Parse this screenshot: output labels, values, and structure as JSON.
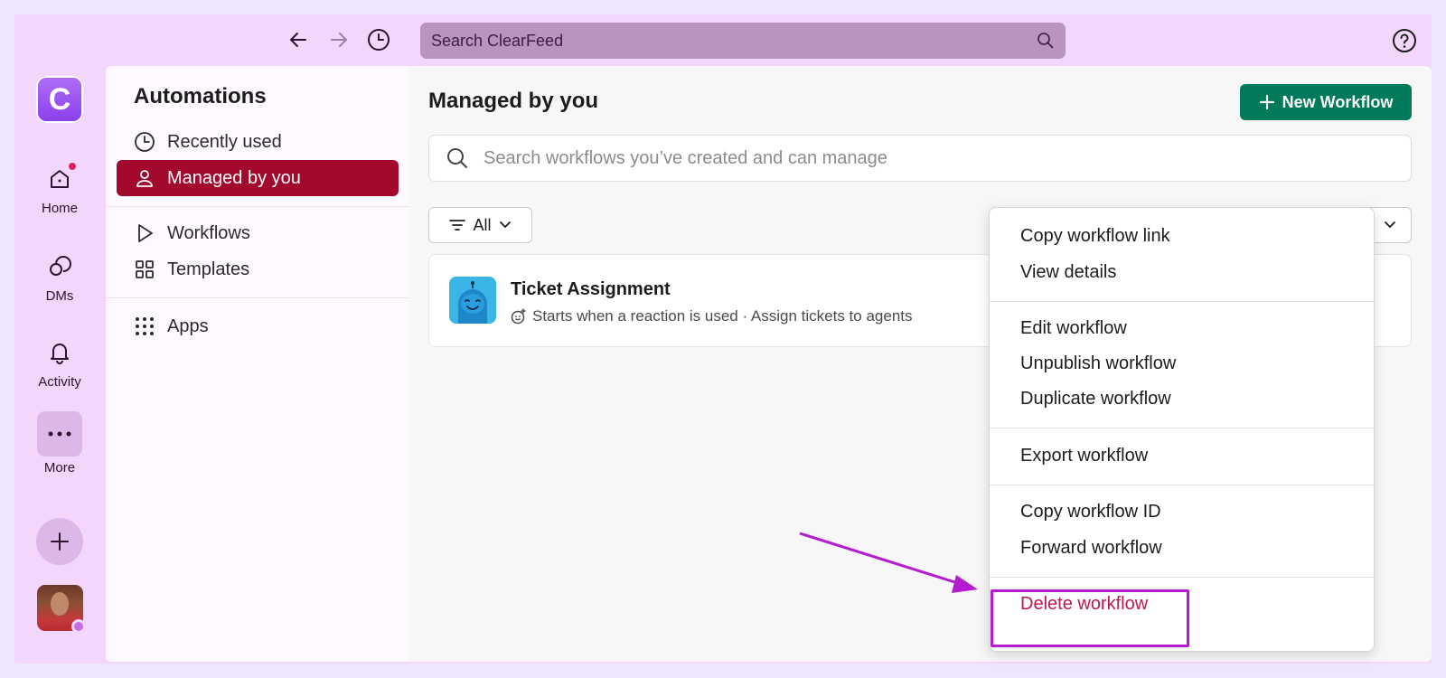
{
  "topbar": {
    "back_icon": "arrow-left-icon",
    "forward_icon": "arrow-right-icon",
    "history_icon": "clock-icon",
    "search_placeholder": "Search ClearFeed",
    "help_icon": "question-circle-icon"
  },
  "rail": {
    "logo_letter": "C",
    "items": [
      {
        "label": "Home",
        "icon": "home-icon"
      },
      {
        "label": "DMs",
        "icon": "message-icon"
      },
      {
        "label": "Activity",
        "icon": "bell-icon"
      },
      {
        "label": "More",
        "icon": "ellipsis-icon"
      }
    ],
    "notification_color": "#e01e5a"
  },
  "sidebar": {
    "title": "Automations",
    "items": [
      {
        "label": "Recently used",
        "icon": "clock-icon"
      },
      {
        "label": "Managed by you",
        "icon": "person-icon",
        "active": true
      },
      {
        "label": "Workflows",
        "icon": "play-icon"
      },
      {
        "label": "Templates",
        "icon": "grid-icon"
      },
      {
        "label": "Apps",
        "icon": "dots-grid-icon"
      }
    ]
  },
  "main": {
    "title": "Managed by you",
    "new_button_label": "New Workflow",
    "search_placeholder": "Search workflows you’ve created and can manage",
    "filter_label": "All",
    "workflow": {
      "title": "Ticket Assignment",
      "subtitle": "Starts when a reaction is used · Assign tickets to agents"
    }
  },
  "context_menu": {
    "groups": [
      [
        "Copy workflow link",
        "View details"
      ],
      [
        "Edit workflow",
        "Unpublish workflow",
        "Duplicate workflow"
      ],
      [
        "Export workflow"
      ],
      [
        "Copy workflow ID",
        "Forward workflow"
      ],
      [
        "Delete workflow"
      ]
    ]
  },
  "colors": {
    "active_item": "#a2092d",
    "primary_button": "#007a5a",
    "danger_text": "#c0174d",
    "annotation": "#b51bd0"
  }
}
